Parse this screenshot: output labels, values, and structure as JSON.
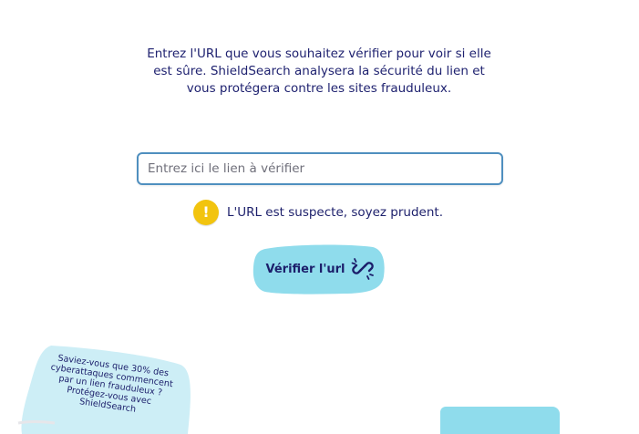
{
  "intro": {
    "text": "Entrez l'URL que vous souhaitez vérifier pour voir si elle est sûre. ShieldSearch analysera la sécurité du lien et vous protégera contre les sites frauduleux."
  },
  "url_input": {
    "placeholder": "Entrez ici le lien à vérifier",
    "value": ""
  },
  "alert": {
    "icon": "exclamation-icon",
    "symbol": "!",
    "message": "L'URL est suspecte, soyez prudent.",
    "color": "#f2c40f"
  },
  "verify_button": {
    "label": "Vérifier l'url",
    "icon": "link-icon",
    "color": "#8fdcec"
  },
  "tip": {
    "text": "Saviez-vous que 30% des cyberattaques commencent par un lien frauduleux ? Protégez-vous avec ShieldSearch"
  },
  "colors": {
    "text": "#1c1f6b",
    "accent_blue": "#8fdcec",
    "field_border": "#4f8fbf"
  }
}
